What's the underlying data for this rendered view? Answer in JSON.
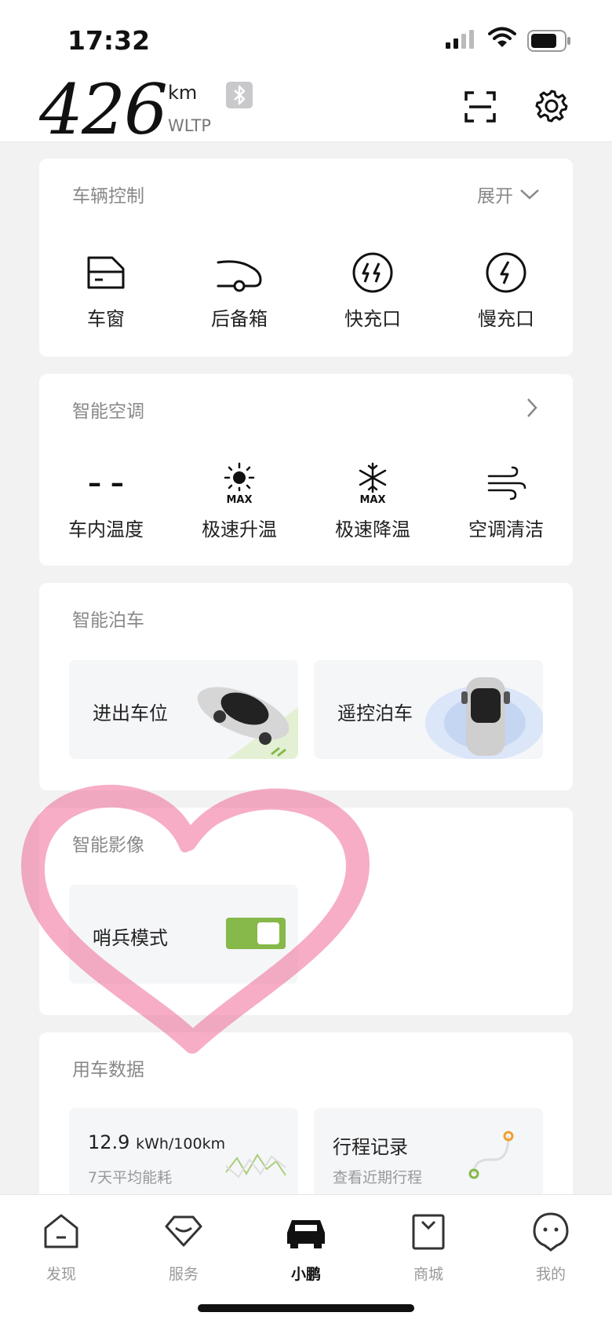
{
  "status_bar": {
    "time": "17:32"
  },
  "header": {
    "range": "426",
    "unit": "km",
    "standard": "WLTP"
  },
  "vehicle_control": {
    "title": "车辆控制",
    "expand_label": "展开",
    "items": [
      {
        "label": "车窗",
        "icon": "window-icon"
      },
      {
        "label": "后备箱",
        "icon": "trunk-icon"
      },
      {
        "label": "快充口",
        "icon": "fast-charge-icon"
      },
      {
        "label": "慢充口",
        "icon": "slow-charge-icon"
      }
    ]
  },
  "climate": {
    "title": "智能空调",
    "items": [
      {
        "label": "车内温度",
        "value": "– –",
        "icon": "temperature-placeholder"
      },
      {
        "label": "极速升温",
        "icon": "max-heat-icon",
        "icon_text": "MAX"
      },
      {
        "label": "极速降温",
        "icon": "max-cool-icon",
        "icon_text": "MAX"
      },
      {
        "label": "空调清洁",
        "icon": "ac-clean-icon"
      }
    ]
  },
  "parking": {
    "title": "智能泊车",
    "tiles": [
      {
        "label": "进出车位"
      },
      {
        "label": "遥控泊车"
      }
    ]
  },
  "imaging": {
    "title": "智能影像",
    "sentry_label": "哨兵模式",
    "sentry_enabled": true
  },
  "usage_data": {
    "title": "用车数据",
    "consumption": {
      "value": "12.9",
      "unit": "kWh/100km",
      "subtitle": "7天平均能耗"
    },
    "trips": {
      "title": "行程记录",
      "subtitle": "查看近期行程"
    }
  },
  "tab_bar": {
    "tabs": [
      {
        "label": "发现"
      },
      {
        "label": "服务"
      },
      {
        "label": "小鹏"
      },
      {
        "label": "商城"
      },
      {
        "label": "我的"
      }
    ],
    "active_index": 2
  },
  "colors": {
    "toggle_on": "#86b84a",
    "heart_overlay": "#f06b97",
    "background": "#f2f2f3"
  }
}
